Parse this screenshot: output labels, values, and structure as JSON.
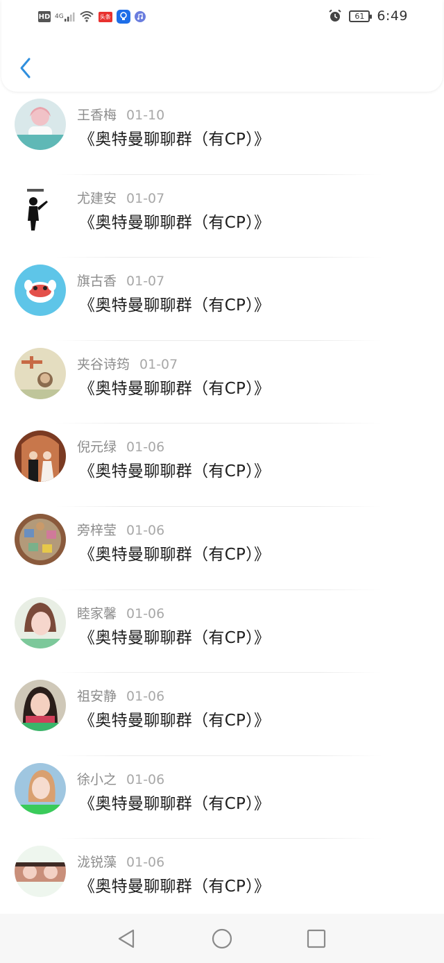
{
  "status_bar": {
    "hd_label": "HD",
    "signal_label": "4G",
    "toutiao_label": "头条",
    "battery_level": "61",
    "time": "6:49"
  },
  "icons": {
    "back": "chevron-left-icon",
    "alarm": "alarm-icon",
    "nav_back": "triangle-back-icon",
    "nav_home": "circle-home-icon",
    "nav_recents": "square-recents-icon"
  },
  "colors": {
    "accent": "#2f8fde",
    "name_text": "#8c8c8c",
    "message_text": "#1e1e1e"
  },
  "messages": [
    {
      "name": "王香梅",
      "date": "01-10",
      "text": "《奥特曼聊聊群（有CP）》"
    },
    {
      "name": "尤建安",
      "date": "01-07",
      "text": "《奥特曼聊聊群（有CP）》"
    },
    {
      "name": "旗古香",
      "date": "01-07",
      "text": "《奥特曼聊聊群（有CP）》"
    },
    {
      "name": "夹谷诗筠",
      "date": "01-07",
      "text": "《奥特曼聊聊群（有CP）》"
    },
    {
      "name": "倪元绿",
      "date": "01-06",
      "text": "《奥特曼聊聊群（有CP）》"
    },
    {
      "name": "旁梓莹",
      "date": "01-06",
      "text": "《奥特曼聊聊群（有CP）》"
    },
    {
      "name": "睦家馨",
      "date": "01-06",
      "text": "《奥特曼聊聊群（有CP）》"
    },
    {
      "name": "祖安静",
      "date": "01-06",
      "text": "《奥特曼聊聊群（有CP）》"
    },
    {
      "name": "徐小之",
      "date": "01-06",
      "text": "《奥特曼聊聊群（有CP）》"
    },
    {
      "name": "泷锐藻",
      "date": "01-06",
      "text": "《奥特曼聊聊群（有CP）》"
    }
  ]
}
